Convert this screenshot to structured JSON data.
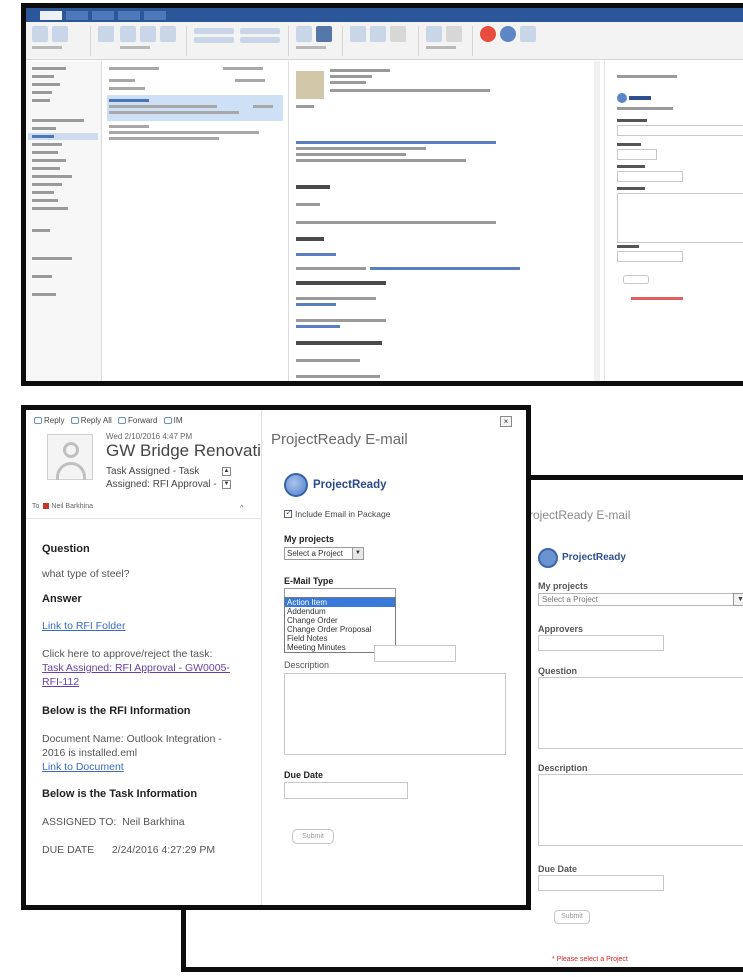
{
  "email": {
    "toolbar": [
      "Reply",
      "Reply All",
      "Forward",
      "IM"
    ],
    "date": "Wed 2/10/2016 4:47 PM",
    "sender": "GW Bridge Renovati",
    "subject_line1": "Task Assigned - Task",
    "subject_line2": "Assigned: RFI Approval -",
    "to_label": "To",
    "to_name": "Neil Barkhina",
    "question_heading": "Question",
    "question_text": "what type of steel?",
    "answer_heading": "Answer",
    "rfi_folder_link": "Link to RFI Folder",
    "approve_text": "Click here to approve/reject the task:",
    "task_link": "Task Assigned: RFI Approval - GW0005-RFI-112",
    "rfi_info_heading": "Below is the RFI Information",
    "doc_name_text": "Document Name: Outlook Integration - 2016 is installed.eml",
    "doc_link": "Link to Document",
    "task_info_heading": "Below is the Task Information",
    "assigned_to_label": "ASSIGNED TO:",
    "assigned_to_value": "Neil Barkhina",
    "due_date_label": "DUE DATE",
    "due_date_value": "2/24/2016 4:27:29 PM"
  },
  "projectready_front": {
    "title": "ProjectReady E-mail",
    "logo_text": "ProjectReady",
    "include_label": "Include Email in Package",
    "my_projects_label": "My projects",
    "select_placeholder": "Select a Project",
    "email_type_label": "E-Mail Type",
    "email_type_options": [
      "Action Item",
      "Addendum",
      "Change Order",
      "Change Order Proposal",
      "Field Notes",
      "Meeting Minutes"
    ],
    "email_type_selected": "Action Item",
    "description_label": "Description",
    "due_date_label": "Due Date",
    "submit_label": "Submit"
  },
  "projectready_back": {
    "title": "ProjectReady E-mail",
    "logo_text": "ProjectReady",
    "my_projects_label": "My projects",
    "select_placeholder": "Select a Project",
    "approvers_label": "Approvers",
    "question_label": "Question",
    "description_label": "Description",
    "due_date_label": "Due Date",
    "submit_label": "Submit",
    "warning": "* Please select a Project"
  },
  "colors": {
    "outlook_blue": "#2b579a",
    "link_blue": "#3a6bc4",
    "dropdown_highlight": "#3879d9",
    "warning_red": "#e02020",
    "frame_black": "#0d0d0d"
  }
}
